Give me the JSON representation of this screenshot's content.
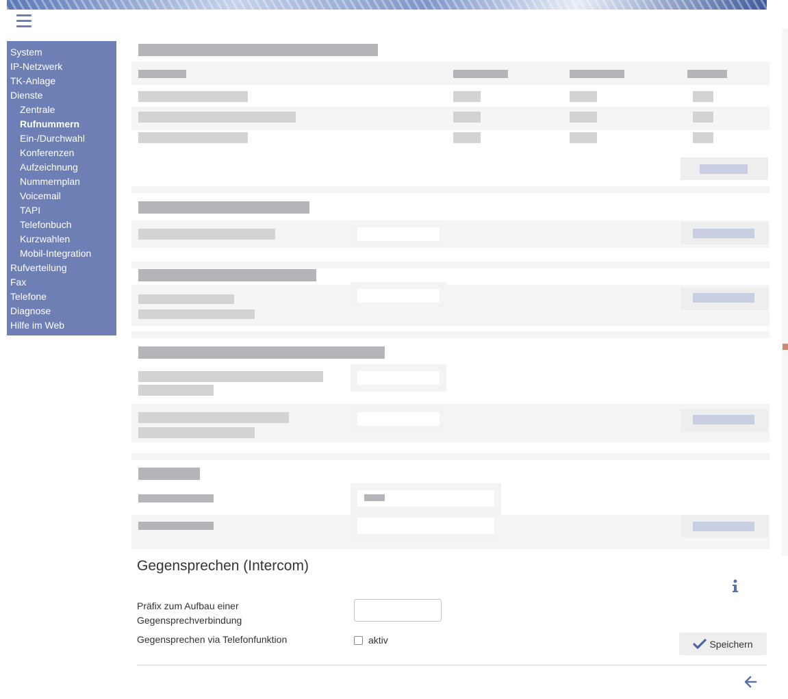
{
  "menu": {
    "icon": "hamburger-menu-icon"
  },
  "sidebar": {
    "items": [
      {
        "label": "System"
      },
      {
        "label": "IP-Netzwerk"
      },
      {
        "label": "TK-Anlage"
      },
      {
        "label": "Dienste"
      },
      {
        "label": "Zentrale"
      },
      {
        "label": "Rufnummern"
      },
      {
        "label": "Ein-/Durchwahl"
      },
      {
        "label": "Konferenzen"
      },
      {
        "label": "Aufzeichnung"
      },
      {
        "label": "Nummernplan"
      },
      {
        "label": "Voicemail"
      },
      {
        "label": "TAPI"
      },
      {
        "label": "Telefonbuch"
      },
      {
        "label": "Kurzwahlen"
      },
      {
        "label": "Mobil-Integration"
      },
      {
        "label": "Rufverteilung"
      },
      {
        "label": "Fax"
      },
      {
        "label": "Telefone"
      },
      {
        "label": "Diagnose"
      },
      {
        "label": "Hilfe im Web"
      }
    ],
    "active": "Rufnummern"
  },
  "intercom": {
    "title": "Gegensprechen (Intercom)",
    "prefix_label_line1": "Präfix zum Aufbau einer",
    "prefix_label_line2": "Gegensprechverbindung",
    "prefix_value": "",
    "phone_function_label": "Gegensprechen via Telefonfunktion",
    "checkbox_label": "aktiv",
    "checkbox_checked": false,
    "save_label": "Speichern"
  },
  "colors": {
    "sidebar_bg": "#6d7fb5",
    "accent": "#5b6fa6",
    "save_check": "#4a64a3"
  }
}
